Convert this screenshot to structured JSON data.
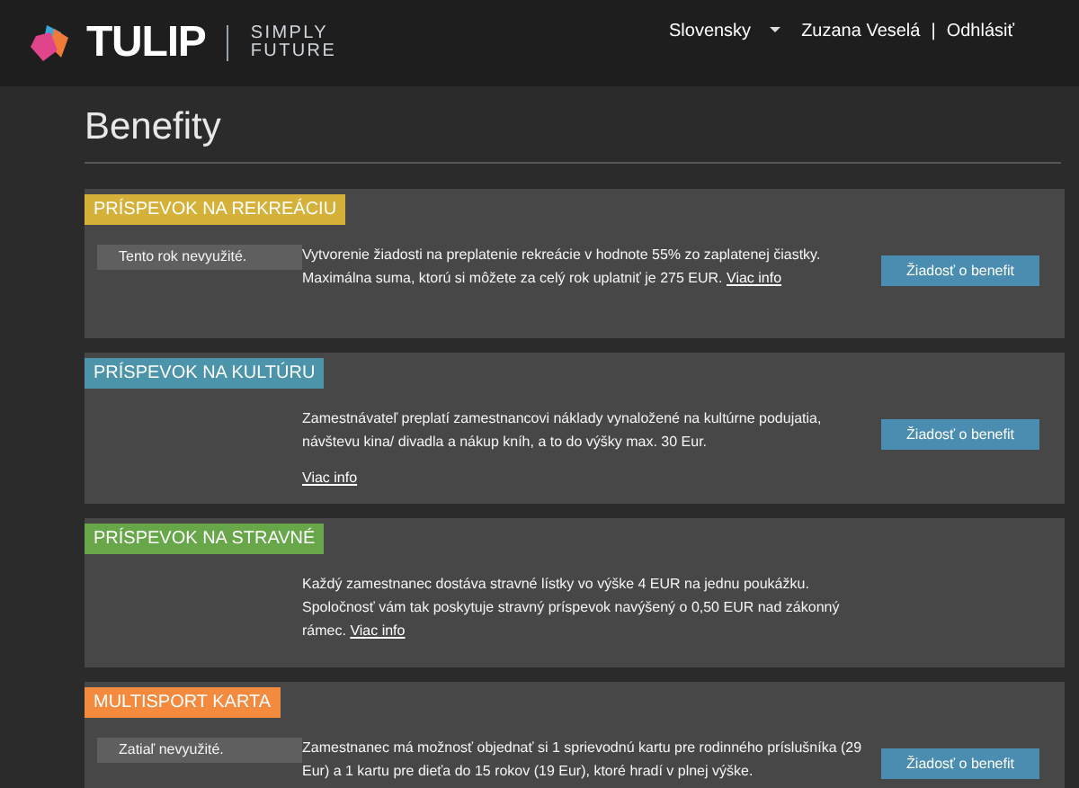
{
  "header": {
    "logo": {
      "name": "TULIP",
      "tagline_lines": [
        "SIMPLY",
        "FUTURE"
      ]
    },
    "language": "Slovensky",
    "user": "Zuzana Veselá",
    "separator": "|",
    "logout": "Odhlásiť"
  },
  "page_title": "Benefity",
  "benefits": [
    {
      "title": "PRÍSPEVOK NA REKREÁCIU",
      "color": "#d6b13a",
      "status": "Tento rok nevyužité.",
      "text": "Vytvorenie žiadosti na preplatenie rekreácie v hodnote 55% zo zaplatenej čiastky. Maximálna suma, ktorú si môžete za celý rok uplatniť je 275 EUR.",
      "link": "Viac info",
      "kind": "inline-link",
      "button": "Žiadosť o benefit"
    },
    {
      "title": "PRÍSPEVOK NA KULTÚRU",
      "color": "#4b94a9",
      "text": "Zamestnávateľ preplatí zamestnancovi náklady vynaložené na kultúrne podujatia, návštevu kina/ divadla a nákup kníh, a to do výšky max. 30 Eur.",
      "link": "Viac info",
      "kind": "block-link",
      "button": "Žiadosť o benefit"
    },
    {
      "title": "PRÍSPEVOK NA STRAVNÉ",
      "color": "#68a64a",
      "text": "Každý zamestnanec dostáva stravné lístky vo výške 4 EUR na jednu poukážku. Spoločnosť vám tak poskytuje stravný príspevok navýšený o 0,50 EUR nad zákonný rámec.",
      "link": "Viac info",
      "kind": "inline-link"
    },
    {
      "title": "MULTISPORT KARTA",
      "color": "#f38a3e",
      "status": "Zatiaľ nevyužité.",
      "text": "Zamestnanec má možnosť objednať si 1 sprievodnú kartu pre rodinného príslušníka (29 Eur) a 1 kartu pre dieťa do 15 rokov (19 Eur), ktoré hradí v plnej výške.",
      "button": "Žiadosť o benefit"
    }
  ]
}
